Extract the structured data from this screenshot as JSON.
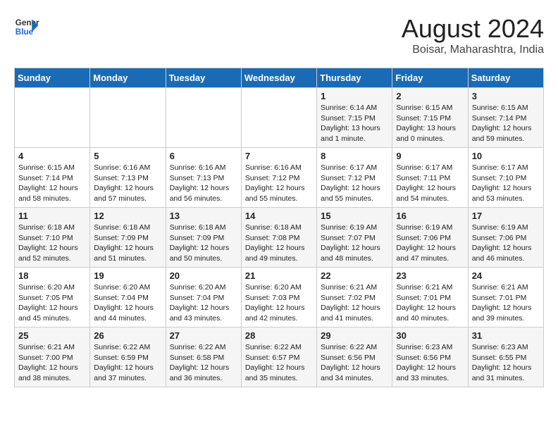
{
  "logo": {
    "line1": "General",
    "line2": "Blue"
  },
  "title": "August 2024",
  "location": "Boisar, Maharashtra, India",
  "days_of_week": [
    "Sunday",
    "Monday",
    "Tuesday",
    "Wednesday",
    "Thursday",
    "Friday",
    "Saturday"
  ],
  "weeks": [
    [
      {
        "day": "",
        "info": ""
      },
      {
        "day": "",
        "info": ""
      },
      {
        "day": "",
        "info": ""
      },
      {
        "day": "",
        "info": ""
      },
      {
        "day": "1",
        "info": "Sunrise: 6:14 AM\nSunset: 7:15 PM\nDaylight: 13 hours\nand 1 minute."
      },
      {
        "day": "2",
        "info": "Sunrise: 6:15 AM\nSunset: 7:15 PM\nDaylight: 13 hours\nand 0 minutes."
      },
      {
        "day": "3",
        "info": "Sunrise: 6:15 AM\nSunset: 7:14 PM\nDaylight: 12 hours\nand 59 minutes."
      }
    ],
    [
      {
        "day": "4",
        "info": "Sunrise: 6:15 AM\nSunset: 7:14 PM\nDaylight: 12 hours\nand 58 minutes."
      },
      {
        "day": "5",
        "info": "Sunrise: 6:16 AM\nSunset: 7:13 PM\nDaylight: 12 hours\nand 57 minutes."
      },
      {
        "day": "6",
        "info": "Sunrise: 6:16 AM\nSunset: 7:13 PM\nDaylight: 12 hours\nand 56 minutes."
      },
      {
        "day": "7",
        "info": "Sunrise: 6:16 AM\nSunset: 7:12 PM\nDaylight: 12 hours\nand 55 minutes."
      },
      {
        "day": "8",
        "info": "Sunrise: 6:17 AM\nSunset: 7:12 PM\nDaylight: 12 hours\nand 55 minutes."
      },
      {
        "day": "9",
        "info": "Sunrise: 6:17 AM\nSunset: 7:11 PM\nDaylight: 12 hours\nand 54 minutes."
      },
      {
        "day": "10",
        "info": "Sunrise: 6:17 AM\nSunset: 7:10 PM\nDaylight: 12 hours\nand 53 minutes."
      }
    ],
    [
      {
        "day": "11",
        "info": "Sunrise: 6:18 AM\nSunset: 7:10 PM\nDaylight: 12 hours\nand 52 minutes."
      },
      {
        "day": "12",
        "info": "Sunrise: 6:18 AM\nSunset: 7:09 PM\nDaylight: 12 hours\nand 51 minutes."
      },
      {
        "day": "13",
        "info": "Sunrise: 6:18 AM\nSunset: 7:09 PM\nDaylight: 12 hours\nand 50 minutes."
      },
      {
        "day": "14",
        "info": "Sunrise: 6:18 AM\nSunset: 7:08 PM\nDaylight: 12 hours\nand 49 minutes."
      },
      {
        "day": "15",
        "info": "Sunrise: 6:19 AM\nSunset: 7:07 PM\nDaylight: 12 hours\nand 48 minutes."
      },
      {
        "day": "16",
        "info": "Sunrise: 6:19 AM\nSunset: 7:06 PM\nDaylight: 12 hours\nand 47 minutes."
      },
      {
        "day": "17",
        "info": "Sunrise: 6:19 AM\nSunset: 7:06 PM\nDaylight: 12 hours\nand 46 minutes."
      }
    ],
    [
      {
        "day": "18",
        "info": "Sunrise: 6:20 AM\nSunset: 7:05 PM\nDaylight: 12 hours\nand 45 minutes."
      },
      {
        "day": "19",
        "info": "Sunrise: 6:20 AM\nSunset: 7:04 PM\nDaylight: 12 hours\nand 44 minutes."
      },
      {
        "day": "20",
        "info": "Sunrise: 6:20 AM\nSunset: 7:04 PM\nDaylight: 12 hours\nand 43 minutes."
      },
      {
        "day": "21",
        "info": "Sunrise: 6:20 AM\nSunset: 7:03 PM\nDaylight: 12 hours\nand 42 minutes."
      },
      {
        "day": "22",
        "info": "Sunrise: 6:21 AM\nSunset: 7:02 PM\nDaylight: 12 hours\nand 41 minutes."
      },
      {
        "day": "23",
        "info": "Sunrise: 6:21 AM\nSunset: 7:01 PM\nDaylight: 12 hours\nand 40 minutes."
      },
      {
        "day": "24",
        "info": "Sunrise: 6:21 AM\nSunset: 7:01 PM\nDaylight: 12 hours\nand 39 minutes."
      }
    ],
    [
      {
        "day": "25",
        "info": "Sunrise: 6:21 AM\nSunset: 7:00 PM\nDaylight: 12 hours\nand 38 minutes."
      },
      {
        "day": "26",
        "info": "Sunrise: 6:22 AM\nSunset: 6:59 PM\nDaylight: 12 hours\nand 37 minutes."
      },
      {
        "day": "27",
        "info": "Sunrise: 6:22 AM\nSunset: 6:58 PM\nDaylight: 12 hours\nand 36 minutes."
      },
      {
        "day": "28",
        "info": "Sunrise: 6:22 AM\nSunset: 6:57 PM\nDaylight: 12 hours\nand 35 minutes."
      },
      {
        "day": "29",
        "info": "Sunrise: 6:22 AM\nSunset: 6:56 PM\nDaylight: 12 hours\nand 34 minutes."
      },
      {
        "day": "30",
        "info": "Sunrise: 6:23 AM\nSunset: 6:56 PM\nDaylight: 12 hours\nand 33 minutes."
      },
      {
        "day": "31",
        "info": "Sunrise: 6:23 AM\nSunset: 6:55 PM\nDaylight: 12 hours\nand 31 minutes."
      }
    ]
  ]
}
